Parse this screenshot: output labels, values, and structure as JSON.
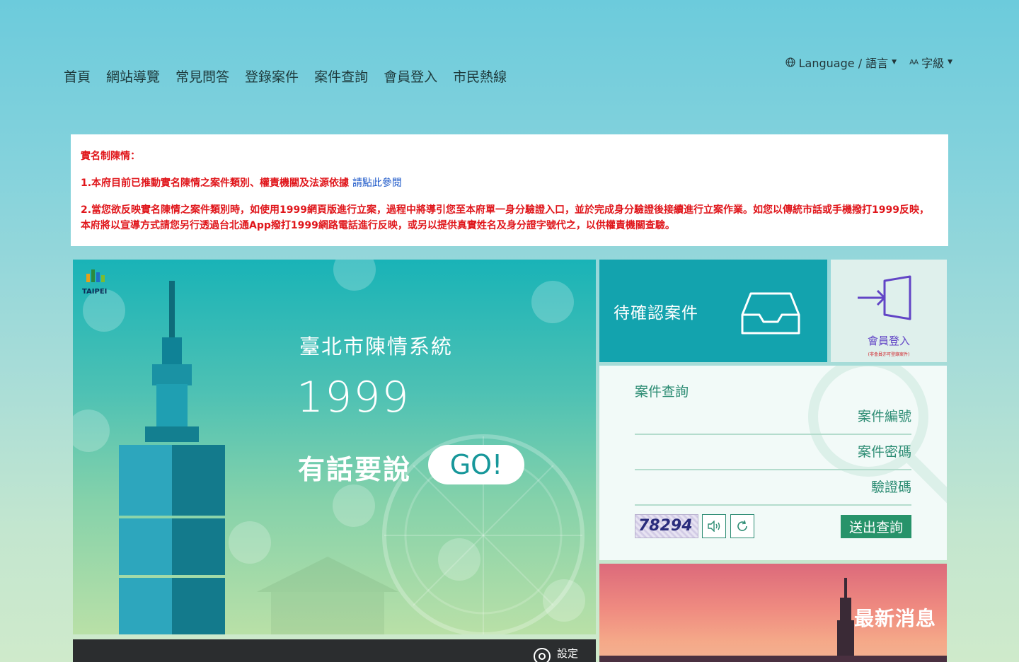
{
  "nav": {
    "items": [
      "首頁",
      "網站導覽",
      "常見問答",
      "登錄案件",
      "案件查詢",
      "會員登入",
      "市民熱線"
    ]
  },
  "util": {
    "language": "Language / 語言",
    "font_size": "字級",
    "aa_glyph": "AA"
  },
  "notice": {
    "title": "實名制陳情：",
    "line1": "1.本府目前已推動實名陳情之案件類別、權責機關及法源依據",
    "line1_link": "請點此參閱",
    "line2": "2.當您欲反映實名陳情之案件類別時，如使用1999網頁版進行立案，過程中將導引您至本府單一身分驗證入口，並於完成身分驗證後接續進行立案作業。如您以傳統市話或手機撥打1999反映，本府將以宣導方式請您另行透過台北通App撥打1999網路電話進行反映，或另以提供真實姓名及身分證字號代之，以供權責機關查驗。"
  },
  "hero": {
    "logo_text": "TAIPEI",
    "title": "臺北市陳情系統",
    "number": "1999",
    "slogan": "有話要說",
    "go": "GO!"
  },
  "strip": {
    "settings": "設定"
  },
  "tiles": {
    "pending": "待確認案件",
    "member": "會員登入",
    "member_note": "(非會員亦可登錄案件)",
    "news": "最新消息"
  },
  "query": {
    "title": "案件查詢",
    "case_number_placeholder": "案件編號",
    "case_password_placeholder": "案件密碼",
    "captcha_placeholder": "驗證碼",
    "captcha_value": "78294",
    "submit": "送出查詢"
  },
  "colors": {
    "accent": "#13a3ae",
    "submit": "#27936a",
    "notice_red": "#e0161b",
    "link_blue": "#1a56c8",
    "member_purple": "#6245c6"
  }
}
